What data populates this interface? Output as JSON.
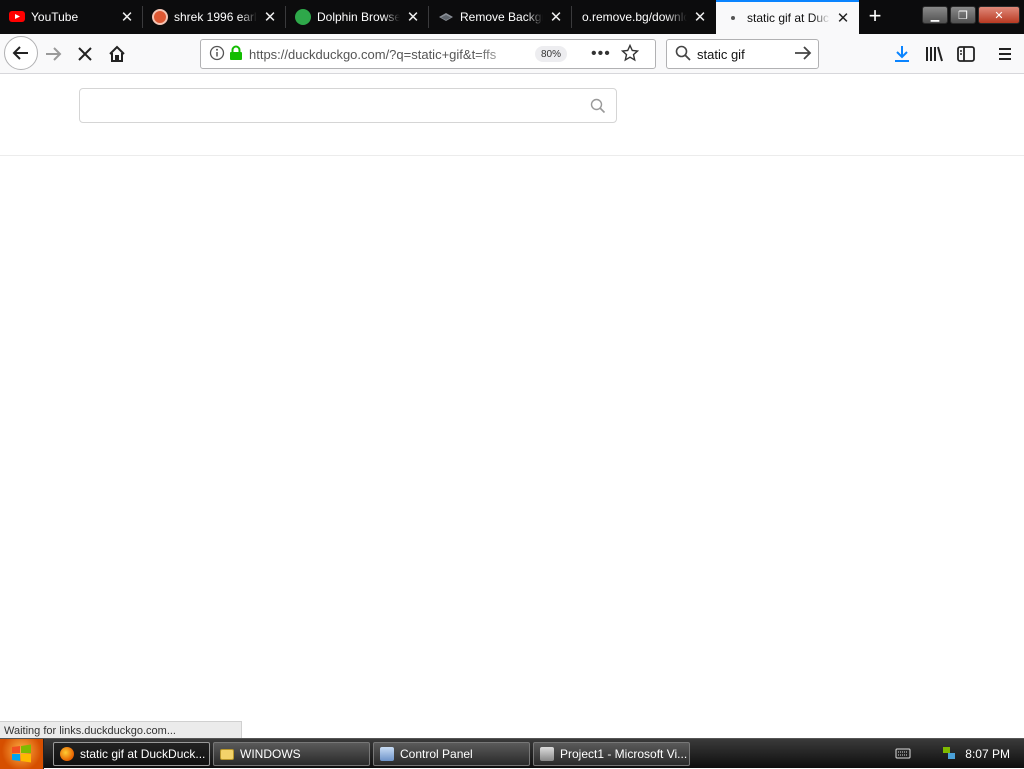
{
  "tabs": [
    {
      "title": "YouTube",
      "icon": "youtube-icon"
    },
    {
      "title": "shrek 1996 early",
      "icon": "duckduckgo-icon"
    },
    {
      "title": "Dolphin Browser",
      "icon": "dolphin-icon"
    },
    {
      "title": "Remove Backgrou",
      "icon": "remove-bg-icon"
    },
    {
      "title": "o.remove.bg/downloa",
      "icon": ""
    },
    {
      "title": "static gif at Duck",
      "icon": "loading-dot-icon"
    }
  ],
  "address_bar": {
    "url": "https://duckduckgo.com/?q=static+gif&t=ffs",
    "zoom": "80%"
  },
  "search_bar": {
    "value": "static gif"
  },
  "page": {
    "search_value": ""
  },
  "status_text": "Waiting for links.duckduckgo.com...",
  "taskbar": {
    "items": [
      {
        "label": "static gif at DuckDuck...",
        "icon": "firefox-icon"
      },
      {
        "label": "WINDOWS",
        "icon": "folder-icon"
      },
      {
        "label": "Control Panel",
        "icon": "control-panel-icon"
      },
      {
        "label": "Project1 - Microsoft Vi...",
        "icon": "visual-basic-icon"
      }
    ],
    "clock": "8:07 PM"
  },
  "colors": {
    "accent": "#0a84ff",
    "tabstrip": "#0c0c0d",
    "secure_lock": "#12bc00"
  }
}
